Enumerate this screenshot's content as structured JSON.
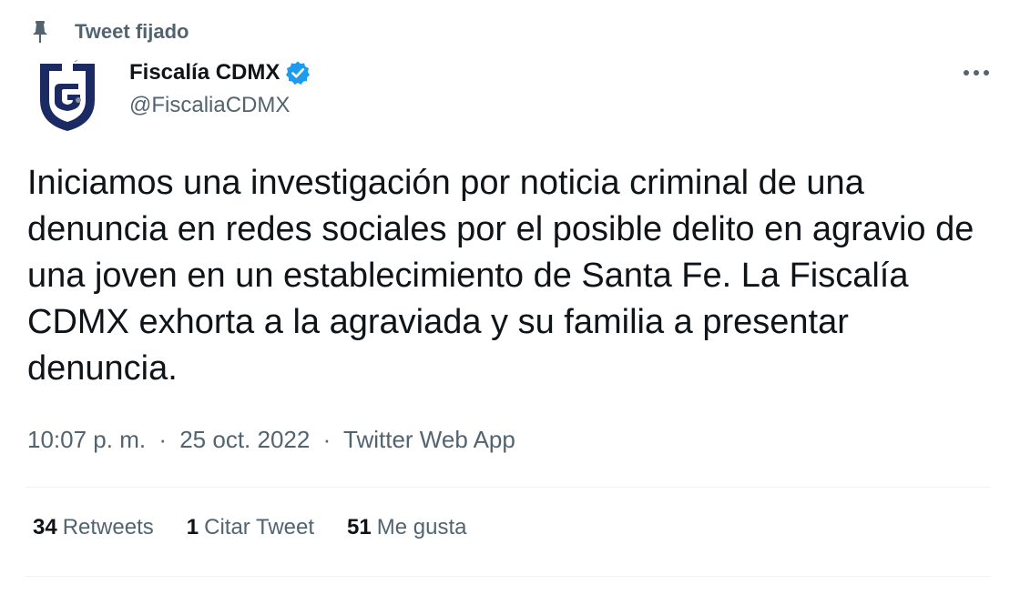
{
  "pinned": {
    "label": "Tweet fijado",
    "icon": "pin-icon"
  },
  "author": {
    "display_name": "Fiscalía CDMX",
    "handle": "@FiscaliaCDMX",
    "verified": true,
    "verified_color": "#1d9bf0",
    "avatar_icon": "fgj-logo",
    "avatar_color": "#1b2a63"
  },
  "more_icon": "ellipsis-icon",
  "tweet": {
    "text": "Iniciamos una investigación por noticia criminal de una denuncia en redes sociales por el posible delito en agravio de una joven en un establecimiento de Santa Fe. La Fiscalía CDMX exhorta a la agraviada y su familia a presentar denuncia."
  },
  "meta": {
    "time": "10:07 p. m.",
    "separator": "·",
    "date": "25 oct. 2022",
    "source": "Twitter Web App"
  },
  "stats": {
    "retweets": {
      "count": "34",
      "label": "Retweets"
    },
    "quotes": {
      "count": "1",
      "label": "Citar Tweet"
    },
    "likes": {
      "count": "51",
      "label": "Me gusta"
    }
  },
  "colors": {
    "text_primary": "#0f1419",
    "text_secondary": "#536471",
    "divider": "#eff3f4"
  }
}
